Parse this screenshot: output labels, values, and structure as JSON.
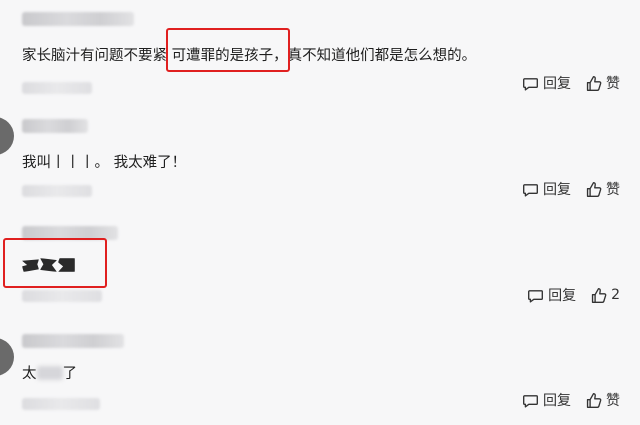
{
  "comments": [
    {
      "text_before": "家长脑汁有问题不要紧 ",
      "text_highlight": "可遭罪的是孩子",
      "text_after": "，真不知道他们都是怎么想的。",
      "reply_label": "回复",
      "like_label": "赞",
      "like_count": ""
    },
    {
      "text": "我叫丨丨丨。 我太难了！",
      "reply_label": "回复",
      "like_label": "赞",
      "like_count": ""
    },
    {
      "text": "",
      "reply_label": "回复",
      "like_label": "",
      "like_count": "2"
    },
    {
      "text_start": "太",
      "text_end": "了",
      "reply_label": "回复",
      "like_label": "赞",
      "like_count": ""
    }
  ],
  "colors": {
    "highlight_border": "#e02020",
    "background": "#f7f7f8"
  },
  "icons": [
    "comment-bubble-icon",
    "thumbs-up-icon",
    "avatar",
    "emoji-sticker"
  ]
}
